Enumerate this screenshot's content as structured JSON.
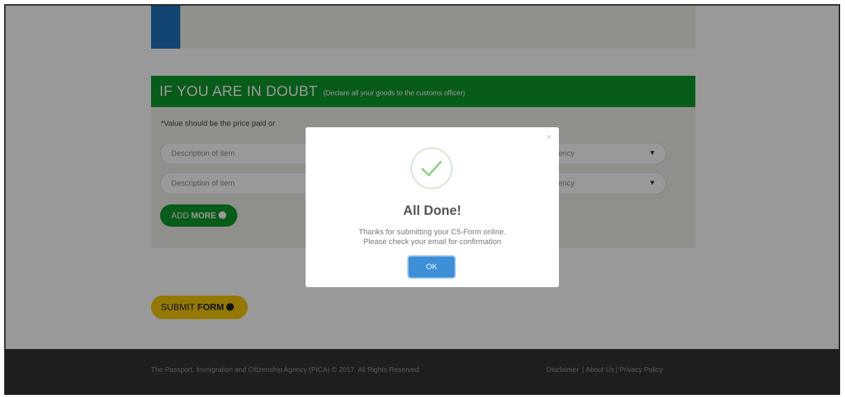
{
  "section": {
    "title": "IF YOU ARE IN DOUBT",
    "subtitle": "(Declare all your goods to the customs officer)",
    "value_note": "*Value should be the price paid or"
  },
  "rows": [
    {
      "description_placeholder": "Description of item",
      "currency_placeholder": "ency"
    },
    {
      "description_placeholder": "Description of item",
      "currency_placeholder": "ency"
    }
  ],
  "buttons": {
    "add_more_prefix": "ADD ",
    "add_more_bold": "MORE",
    "submit_prefix": "SUBMIT ",
    "submit_bold": "FORM"
  },
  "footer": {
    "copyright": "The Passport, Immigration and Citizenship Agency (PICA) © 2017. All Rights Reserved.",
    "links": [
      "Disclaimer",
      "About Us",
      "Privacy Policy"
    ]
  },
  "modal": {
    "close": "×",
    "title": "All Done!",
    "line1": "Thanks for submitting your C5-Form online.",
    "line2": "Please check your email for confirmation",
    "ok_label": "OK"
  },
  "colors": {
    "header_green": "#0e9a2a",
    "accent_blue": "#1e73be",
    "submit_yellow": "#f5c80a",
    "footer_bg": "#333333",
    "ok_blue": "#3f8ed8"
  },
  "icons": {
    "success": "check-circle-icon",
    "chevron": "chevron-down-icon",
    "add": "plus-circle-icon",
    "submit": "arrow-circle-icon"
  }
}
